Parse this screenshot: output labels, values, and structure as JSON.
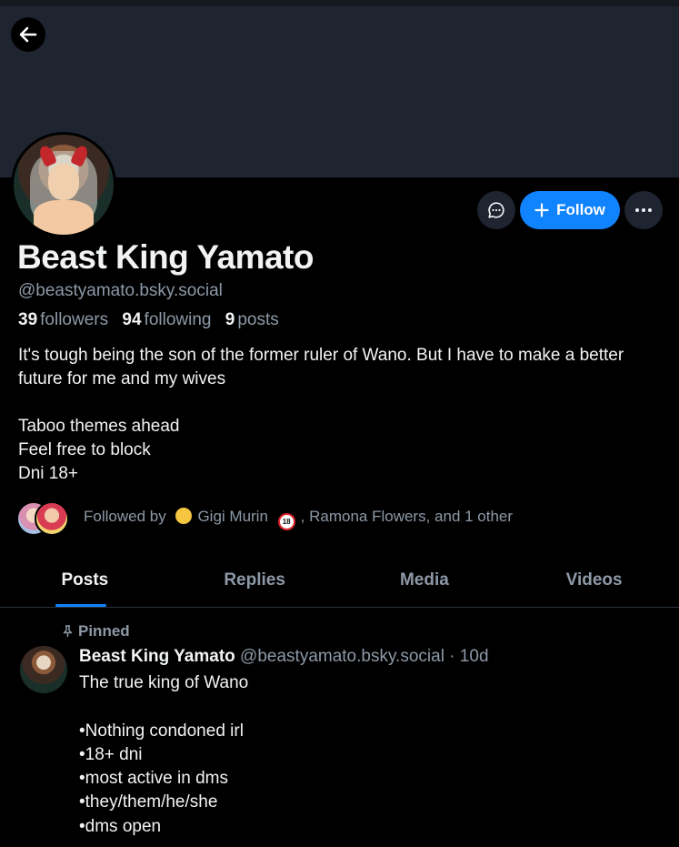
{
  "profile": {
    "display_name": "Beast King Yamato",
    "handle": "@beastyamato.bsky.social",
    "followers_count": "39",
    "followers_label": "followers",
    "following_count": "94",
    "following_label": "following",
    "posts_count": "9",
    "posts_label": "posts",
    "bio": "It's tough being the son of the former ruler of Wano. But I have to make a better future for me and my wives\n\nTaboo themes ahead\nFeel free to block\nDni 18+"
  },
  "actions": {
    "follow_label": "Follow"
  },
  "followed_by": {
    "prefix": "Followed by",
    "name1": "Gigi Murin",
    "rest": ", Ramona Flowers, and 1 other"
  },
  "tabs": [
    {
      "label": "Posts"
    },
    {
      "label": "Replies"
    },
    {
      "label": "Media"
    },
    {
      "label": "Videos"
    }
  ],
  "pinned_post": {
    "pinned_label": "Pinned",
    "author": "Beast King Yamato",
    "handle": "@beastyamato.bsky.social",
    "time": "· 10d",
    "text": "The true king of Wano\n\n•Nothing condoned irl\n•18+ dni\n•most active in dms\n•they/them/he/she\n•dms open"
  },
  "colors": {
    "accent": "#1083fe",
    "banner": "#1e2531",
    "muted_text": "#8d99a7"
  }
}
